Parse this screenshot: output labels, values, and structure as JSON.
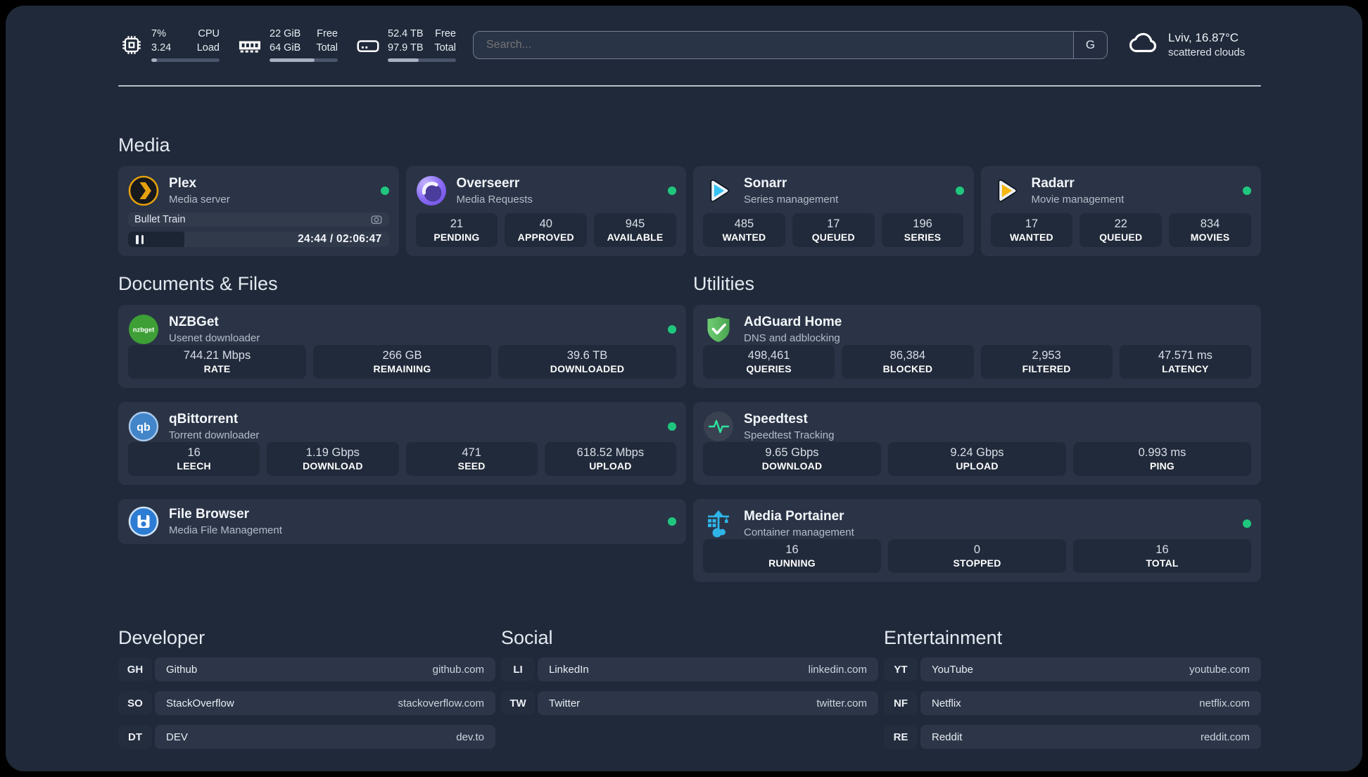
{
  "theme": {
    "page-bg": "#1f2939",
    "card-bg": "#2a3446",
    "tile-bg": "#212a3a",
    "bar-bg": "#2c3648",
    "abbr-bg": "#232d3e",
    "accent-green": "#1fc77e",
    "plex-amber": "#e5a00d",
    "sonarr-blue": "#36c3f2",
    "radarr-amber": "#f7b70f",
    "nzbget-green": "#3d9f35",
    "adguard-green": "#57b65c",
    "qbittorrent-blue": "#4285c9",
    "overseerr-purple": "#7e5ff2",
    "speedtest-green": "#2ee59d",
    "portainer-blue": "#2fb4e8",
    "filebrowser-blue": "#2d7cd3"
  },
  "header": {
    "system_stats": [
      {
        "icon": "cpu-icon",
        "value_top": "7%",
        "value_bottom": "3.24",
        "label_top": "CPU",
        "label_bottom": "Load",
        "progress_pct": 8
      },
      {
        "icon": "ram-icon",
        "value_top": "22 GiB",
        "value_bottom": "64 GiB",
        "label_top": "Free",
        "label_bottom": "Total",
        "progress_pct": 66
      },
      {
        "icon": "disk-icon",
        "value_top": "52.4 TB",
        "value_bottom": "97.9 TB",
        "label_top": "Free",
        "label_bottom": "Total",
        "progress_pct": 45
      }
    ],
    "search": {
      "placeholder": "Search...",
      "button_label": "G"
    },
    "weather": {
      "location": "Lviv, 16.87°C",
      "condition": "scattered clouds"
    }
  },
  "sections": {
    "media": "Media",
    "documents": "Documents & Files",
    "utilities": "Utilities"
  },
  "services": {
    "plex": {
      "name": "Plex",
      "desc": "Media server",
      "now_playing": {
        "title": "Bullet Train",
        "time": "24:44 / 02:06:47",
        "state": "paused"
      }
    },
    "overseerr": {
      "name": "Overseerr",
      "desc": "Media Requests",
      "stats": [
        {
          "value": "21",
          "label": "PENDING"
        },
        {
          "value": "40",
          "label": "APPROVED"
        },
        {
          "value": "945",
          "label": "AVAILABLE"
        }
      ]
    },
    "sonarr": {
      "name": "Sonarr",
      "desc": "Series management",
      "stats": [
        {
          "value": "485",
          "label": "WANTED"
        },
        {
          "value": "17",
          "label": "QUEUED"
        },
        {
          "value": "196",
          "label": "SERIES"
        }
      ]
    },
    "radarr": {
      "name": "Radarr",
      "desc": "Movie management",
      "stats": [
        {
          "value": "17",
          "label": "WANTED"
        },
        {
          "value": "22",
          "label": "QUEUED"
        },
        {
          "value": "834",
          "label": "MOVIES"
        }
      ]
    },
    "nzbget": {
      "name": "NZBGet",
      "desc": "Usenet downloader",
      "icon_text": "nzbget",
      "stats": [
        {
          "value": "744.21 Mbps",
          "label": "RATE"
        },
        {
          "value": "266 GB",
          "label": "REMAINING"
        },
        {
          "value": "39.6 TB",
          "label": "DOWNLOADED"
        }
      ]
    },
    "qbittorrent": {
      "name": "qBittorrent",
      "desc": "Torrent downloader",
      "icon_text": "qb",
      "stats": [
        {
          "value": "16",
          "label": "LEECH"
        },
        {
          "value": "1.19 Gbps",
          "label": "DOWNLOAD"
        },
        {
          "value": "471",
          "label": "SEED"
        },
        {
          "value": "618.52 Mbps",
          "label": "UPLOAD"
        }
      ]
    },
    "filebrowser": {
      "name": "File Browser",
      "desc": "Media File Management"
    },
    "adguard": {
      "name": "AdGuard Home",
      "desc": "DNS and adblocking",
      "stats": [
        {
          "value": "498,461",
          "label": "QUERIES"
        },
        {
          "value": "86,384",
          "label": "BLOCKED"
        },
        {
          "value": "2,953",
          "label": "FILTERED"
        },
        {
          "value": "47.571 ms",
          "label": "LATENCY"
        }
      ]
    },
    "speedtest": {
      "name": "Speedtest",
      "desc": "Speedtest Tracking",
      "stats": [
        {
          "value": "9.65 Gbps",
          "label": "DOWNLOAD"
        },
        {
          "value": "9.24 Gbps",
          "label": "UPLOAD"
        },
        {
          "value": "0.993 ms",
          "label": "PING"
        }
      ]
    },
    "portainer": {
      "name": "Media Portainer",
      "desc": "Container management",
      "stats": [
        {
          "value": "16",
          "label": "RUNNING"
        },
        {
          "value": "0",
          "label": "STOPPED"
        },
        {
          "value": "16",
          "label": "TOTAL"
        }
      ]
    }
  },
  "bookmarks": [
    {
      "title": "Developer",
      "links": [
        {
          "abbr": "GH",
          "name": "Github",
          "url": "github.com"
        },
        {
          "abbr": "SO",
          "name": "StackOverflow",
          "url": "stackoverflow.com"
        },
        {
          "abbr": "DT",
          "name": "DEV",
          "url": "dev.to"
        }
      ]
    },
    {
      "title": "Social",
      "links": [
        {
          "abbr": "LI",
          "name": "LinkedIn",
          "url": "linkedin.com"
        },
        {
          "abbr": "TW",
          "name": "Twitter",
          "url": "twitter.com"
        }
      ]
    },
    {
      "title": "Entertainment",
      "links": [
        {
          "abbr": "YT",
          "name": "YouTube",
          "url": "youtube.com"
        },
        {
          "abbr": "NF",
          "name": "Netflix",
          "url": "netflix.com"
        },
        {
          "abbr": "RE",
          "name": "Reddit",
          "url": "reddit.com"
        }
      ]
    }
  ]
}
